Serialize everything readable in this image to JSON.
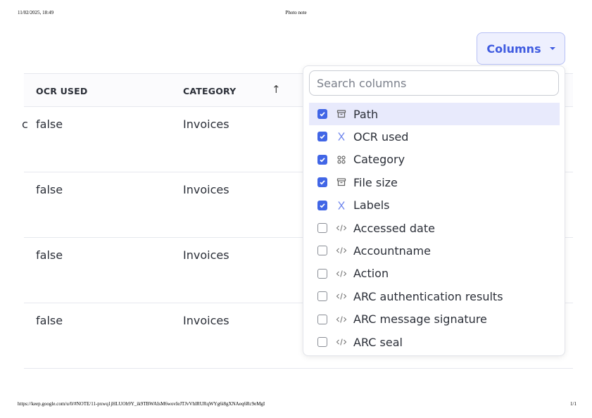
{
  "print_header": {
    "datetime": "11/02/2025, 18:49",
    "title": "Photo note"
  },
  "print_footer": {
    "url": "https://keep.google.com/u/0/#NOTE/11-pxwq1jHLUOb9Y_ik9TBWAIsM6wovIeJTJvVhlRURqWYg6i8gXNAeq6Rc9eMgI",
    "page": "1/1"
  },
  "columns_button": {
    "label": "Columns"
  },
  "colors": {
    "accent": "#4166e6",
    "button_bg": "#eef0fe",
    "highlight": "#e8eafc"
  },
  "table": {
    "headers": {
      "ocr_used": "OCR USED",
      "category": "CATEGORY"
    },
    "sort": {
      "column": "category",
      "direction": "ascending",
      "icon": "arrow-up-icon"
    },
    "truncated_cell": "c",
    "rows": [
      {
        "ocr_used": "false",
        "category": "Invoices"
      },
      {
        "ocr_used": "false",
        "category": "Invoices"
      },
      {
        "ocr_used": "false",
        "category": "Invoices"
      },
      {
        "ocr_used": "false",
        "category": "Invoices"
      }
    ]
  },
  "column_menu": {
    "search_placeholder": "Search columns",
    "search_value": "",
    "items": [
      {
        "label": "Path",
        "checked": true,
        "icon": "archive-box-icon",
        "highlighted": true
      },
      {
        "label": "OCR used",
        "checked": true,
        "icon": "x-mark-icon"
      },
      {
        "label": "Category",
        "checked": true,
        "icon": "grid-icon"
      },
      {
        "label": "File size",
        "checked": true,
        "icon": "archive-box-icon"
      },
      {
        "label": "Labels",
        "checked": true,
        "icon": "x-mark-icon"
      },
      {
        "label": "Accessed date",
        "checked": false,
        "icon": "code-icon"
      },
      {
        "label": "Accountname",
        "checked": false,
        "icon": "code-icon"
      },
      {
        "label": "Action",
        "checked": false,
        "icon": "code-icon"
      },
      {
        "label": "ARC authentication results",
        "checked": false,
        "icon": "code-icon"
      },
      {
        "label": "ARC message signature",
        "checked": false,
        "icon": "code-icon"
      },
      {
        "label": "ARC seal",
        "checked": false,
        "icon": "code-icon"
      }
    ]
  }
}
